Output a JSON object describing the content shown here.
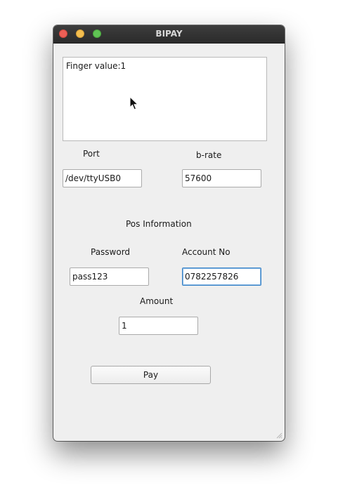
{
  "window": {
    "title": "BIPAY"
  },
  "display": {
    "text": "Finger value:1"
  },
  "serial": {
    "port_label": "Port",
    "port_value": "/dev/ttyUSB0",
    "baud_label": "b-rate",
    "baud_value": "57600"
  },
  "pos": {
    "heading": "Pos Information",
    "password_label": "Password",
    "password_value": "pass123",
    "account_label": "Account No",
    "account_value": "0782257826",
    "amount_label": "Amount",
    "amount_value": "1"
  },
  "actions": {
    "pay_label": "Pay"
  },
  "colors": {
    "close": "#ed5f56",
    "minimize": "#f4be4f",
    "maximize": "#60c454",
    "focus_ring": "#3d86c9"
  }
}
